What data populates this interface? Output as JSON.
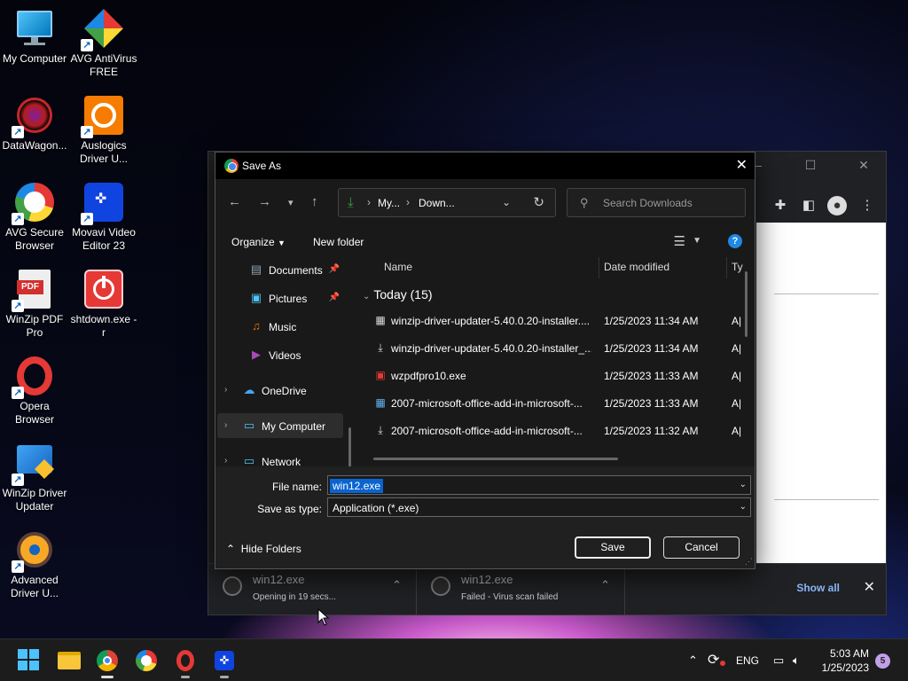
{
  "desktop": {
    "icons": [
      {
        "label": "My Computer"
      },
      {
        "label": "AVG AntiVirus FREE"
      },
      {
        "label": "DataWagon..."
      },
      {
        "label": "Auslogics Driver U..."
      },
      {
        "label": "AVG Secure Browser"
      },
      {
        "label": "Movavi Video Editor 23"
      },
      {
        "label": "WinZip PDF Pro"
      },
      {
        "label": "shtdown.exe -r"
      },
      {
        "label": "Opera Browser"
      },
      {
        "label": "WinZip Driver Updater"
      },
      {
        "label": "Advanced Driver U..."
      }
    ]
  },
  "chrome": {
    "downloads": [
      {
        "name": "win12.exe",
        "status": "Opening in 19 secs..."
      },
      {
        "name": "win12.exe",
        "status": "Failed - Virus scan failed"
      }
    ],
    "show_all": "Show all"
  },
  "dialog": {
    "title": "Save As",
    "address": {
      "crumb1": "My...",
      "crumb2": "Down..."
    },
    "search_placeholder": "Search Downloads",
    "organize": "Organize",
    "new_folder": "New folder",
    "nav": [
      {
        "label": "Documents",
        "icon": "documents-icon"
      },
      {
        "label": "Pictures",
        "icon": "pictures-icon"
      },
      {
        "label": "Music",
        "icon": "music-icon"
      },
      {
        "label": "Videos",
        "icon": "videos-icon"
      },
      {
        "label": "OneDrive",
        "icon": "onedrive-icon"
      },
      {
        "label": "My Computer",
        "icon": "computer-icon"
      },
      {
        "label": "Network",
        "icon": "network-icon"
      }
    ],
    "columns": {
      "name": "Name",
      "date": "Date modified",
      "type": "Ty"
    },
    "group": "Today (15)",
    "files": [
      {
        "name": "winzip-driver-updater-5.40.0.20-installer....",
        "date": "1/25/2023 11:34 AM",
        "type": "A|"
      },
      {
        "name": "winzip-driver-updater-5.40.0.20-installer_...",
        "date": "1/25/2023 11:34 AM",
        "type": "A|"
      },
      {
        "name": "wzpdfpro10.exe",
        "date": "1/25/2023 11:33 AM",
        "type": "A|"
      },
      {
        "name": "2007-microsoft-office-add-in-microsoft-...",
        "date": "1/25/2023 11:33 AM",
        "type": "A|"
      },
      {
        "name": "2007-microsoft-office-add-in-microsoft-...",
        "date": "1/25/2023 11:32 AM",
        "type": "A|"
      }
    ],
    "file_name_label": "File name:",
    "file_name_value": "win12.exe",
    "save_type_label": "Save as type:",
    "save_type_value": "Application (*.exe)",
    "hide_folders": "Hide Folders",
    "save": "Save",
    "cancel": "Cancel"
  },
  "taskbar": {
    "lang": "ENG",
    "time": "5:03 AM",
    "date": "1/25/2023",
    "notifications": "5"
  }
}
